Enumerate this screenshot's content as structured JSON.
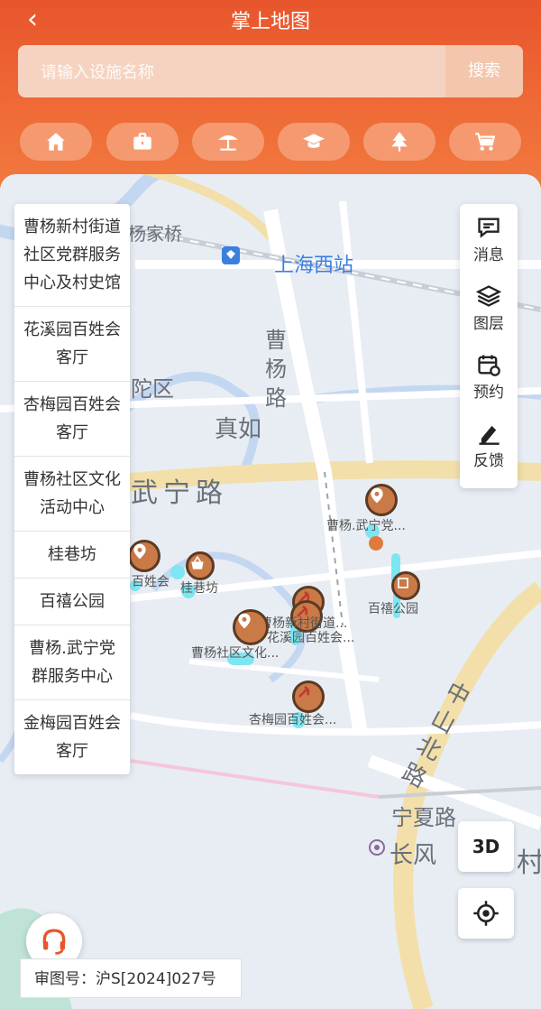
{
  "header": {
    "title": "掌上地图",
    "search_placeholder": "请输入设施名称",
    "search_button": "搜索",
    "categories": [
      {
        "icon": "home-icon"
      },
      {
        "icon": "briefcase-icon"
      },
      {
        "icon": "beach-umbrella-icon"
      },
      {
        "icon": "graduation-cap-icon"
      },
      {
        "icon": "tree-icon"
      },
      {
        "icon": "shopping-cart-icon"
      }
    ]
  },
  "map_labels": {
    "station": "上海西站",
    "bridge": "杨家桥",
    "district": "陀区",
    "road_caoyang": "曹杨路",
    "zhenru": "真如",
    "road_wuning": "武宁路",
    "road_zhongshan": "中山北路",
    "road_ningxia": "宁夏路",
    "changfeng": "长风",
    "village": "村"
  },
  "poi_labels": {
    "p1": "曹杨.武宁党...",
    "p2": "百姓会",
    "p3": "桂巷坊",
    "p4": "曹杨新村街道...",
    "p5": "花溪园百姓会...",
    "p6": "百禧公园",
    "p7": "曹杨社区文化...",
    "p8": "杏梅园百姓会..."
  },
  "facility_list": [
    "曹杨新村街道社区党群服务中心及村史馆",
    "花溪园百姓会客厅",
    "杏梅园百姓会客厅",
    "曹杨社区文化活动中心",
    "桂巷坊",
    "百禧公园",
    "曹杨.武宁党群服务中心",
    "金梅园百姓会客厅"
  ],
  "tools": [
    {
      "label": "消息",
      "icon": "message-icon"
    },
    {
      "label": "图层",
      "icon": "layers-icon"
    },
    {
      "label": "预约",
      "icon": "calendar-icon"
    },
    {
      "label": "反馈",
      "icon": "feedback-icon"
    }
  ],
  "controls": {
    "three_d": "3D"
  },
  "approval_number": "审图号：沪S[2024]027号",
  "colors": {
    "header": "#ee6234",
    "accent": "#e8552c",
    "pin": "#c97a47"
  }
}
